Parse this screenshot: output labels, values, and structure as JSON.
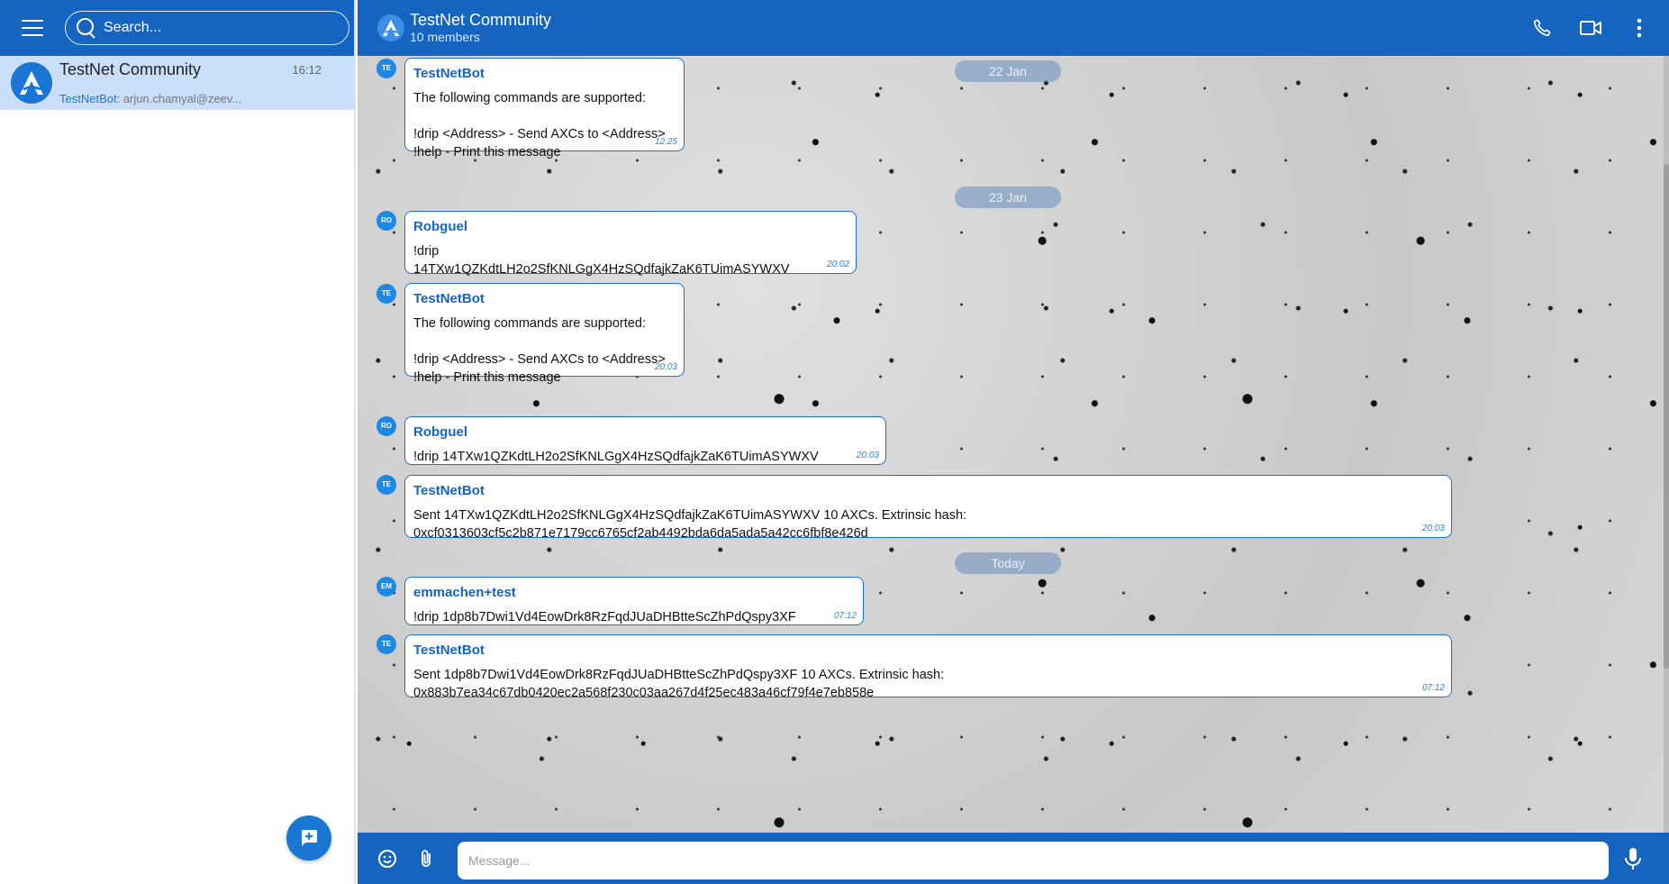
{
  "sidebar": {
    "search": {
      "placeholder": "Search..."
    },
    "chats": [
      {
        "title": "TestNet Community",
        "time": "16:12",
        "preview_sender": "TestNetBot",
        "preview_text": ": arjun.chamyal@zeev..."
      }
    ]
  },
  "header": {
    "title": "TestNet Community",
    "subtitle": "10 members"
  },
  "dates": [
    "22 Jan",
    "23 Jan",
    "Today"
  ],
  "messages": [
    {
      "initials": "TE",
      "author": "TestNetBot",
      "body": "The following commands are supported:\n\n!drip <Address> - Send AXCs to <Address>\n!help - Print this message",
      "time": "12:25"
    },
    {
      "initials": "RO",
      "author": "Robguel",
      "body": "!drip\n14TXw1QZKdtLH2o2SfKNLGgX4HzSQdfajkZaK6TUimASYWXV",
      "time": "20:02"
    },
    {
      "initials": "TE",
      "author": "TestNetBot",
      "body": "The following commands are supported:\n\n!drip <Address> - Send AXCs to <Address>\n!help - Print this message",
      "time": "20:03"
    },
    {
      "initials": "RO",
      "author": "Robguel",
      "body": "!drip 14TXw1QZKdtLH2o2SfKNLGgX4HzSQdfajkZaK6TUimASYWXV",
      "time": "20:03"
    },
    {
      "initials": "TE",
      "author": "TestNetBot",
      "body": "Sent 14TXw1QZKdtLH2o2SfKNLGgX4HzSQdfajkZaK6TUimASYWXV 10 AXCs. Extrinsic hash:\n0xcf0313603cf5c2b871e7179cc6765cf2ab4492bda6da5ada5a42cc6fbf8e426d",
      "time": "20:03"
    },
    {
      "initials": "EM",
      "author": "emmachen+test",
      "body": "!drip 1dp8b7Dwi1Vd4EowDrk8RzFqdJUaDHBtteScZhPdQspy3XF",
      "time": "07:12"
    },
    {
      "initials": "TE",
      "author": "TestNetBot",
      "body": "Sent 1dp8b7Dwi1Vd4EowDrk8RzFqdJUaDHBtteScZhPdQspy3XF 10 AXCs. Extrinsic hash:\n0x883b7ea34c67db0420ec2a568f230c03aa267d4f25ec483a46cf79f4e7eb858e",
      "time": "07:12"
    }
  ],
  "composer": {
    "placeholder": "Message..."
  },
  "icons": {
    "menu": "menu-icon",
    "search": "search-icon",
    "phone": "phone-icon",
    "video": "video-icon",
    "more": "more-vertical-icon",
    "emoji": "emoji-icon",
    "attach": "paperclip-icon",
    "mic": "microphone-icon",
    "new_chat": "new-chat-icon"
  },
  "colors": {
    "brand": "#1565c0",
    "accent": "#1976d2",
    "selected_chat": "#c9def8"
  }
}
